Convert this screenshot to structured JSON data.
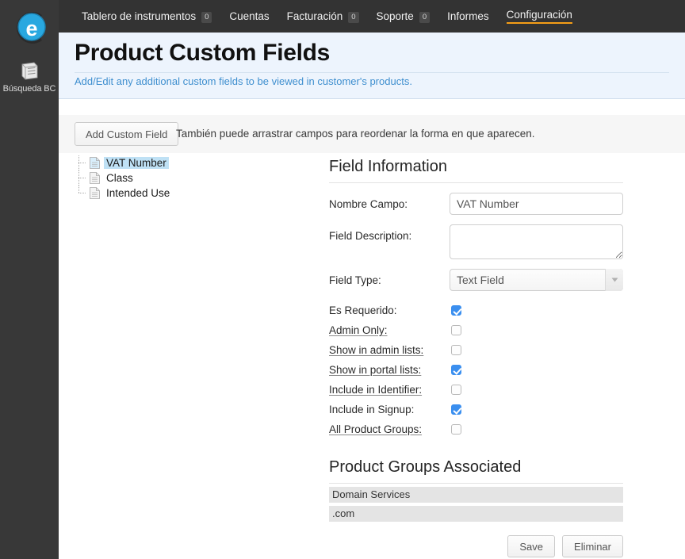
{
  "rail": {
    "logo_name": "e-brand-logo",
    "tool": {
      "icon": "book-icon",
      "label": "Búsqueda BC"
    }
  },
  "topnav": {
    "items": [
      {
        "label": "Tablero de instrumentos",
        "badge": "0",
        "active": false
      },
      {
        "label": "Cuentas",
        "badge": null,
        "active": false
      },
      {
        "label": "Facturación",
        "badge": "0",
        "active": false
      },
      {
        "label": "Soporte",
        "badge": "0",
        "active": false
      },
      {
        "label": "Informes",
        "badge": null,
        "active": false
      },
      {
        "label": "Configuración",
        "badge": null,
        "active": true
      }
    ],
    "active_underline_color": "#f59e17"
  },
  "page": {
    "title": "Product Custom Fields",
    "subtitle": "Add/Edit any additional custom fields to be viewed in customer's products.",
    "subtitle_color": "#3f8fcf",
    "header_bg": "#edf4fd"
  },
  "toolbar": {
    "add_button": "Add Custom Field",
    "hint": "También puede arrastrar campos para reordenar la forma en que aparecen."
  },
  "tree": {
    "items": [
      {
        "label": "VAT Number",
        "selected": true
      },
      {
        "label": "Class",
        "selected": false
      },
      {
        "label": "Intended Use",
        "selected": false
      }
    ],
    "selection_color": "#bfe1f5"
  },
  "field_information": {
    "title": "Field Information",
    "nombre_campo": {
      "label": "Nombre Campo:",
      "value": "VAT Number",
      "placeholder": ""
    },
    "field_description": {
      "label": "Field Description:",
      "value": "",
      "placeholder": ""
    },
    "field_type": {
      "label": "Field Type:",
      "value": "Text Field",
      "arrow_icon": "chevron-down-icon"
    },
    "checkboxes": [
      {
        "label": "Es Requerido:",
        "checked": true,
        "underlined": false
      },
      {
        "label": "Admin Only:",
        "checked": false,
        "underlined": true
      },
      {
        "label": "Show in admin lists:",
        "checked": false,
        "underlined": true
      },
      {
        "label": "Show in portal lists:",
        "checked": true,
        "underlined": true
      },
      {
        "label": "Include in Identifier:",
        "checked": false,
        "underlined": true
      },
      {
        "label": "Include in Signup:",
        "checked": true,
        "underlined": false
      },
      {
        "label": "All Product Groups:",
        "checked": false,
        "underlined": true
      }
    ],
    "checkbox_on_color": "#3b8fef"
  },
  "product_groups": {
    "title": "Product Groups Associated",
    "items": [
      "Domain Services",
      ".com"
    ]
  },
  "actions": {
    "save": "Save",
    "delete": "Eliminar"
  }
}
